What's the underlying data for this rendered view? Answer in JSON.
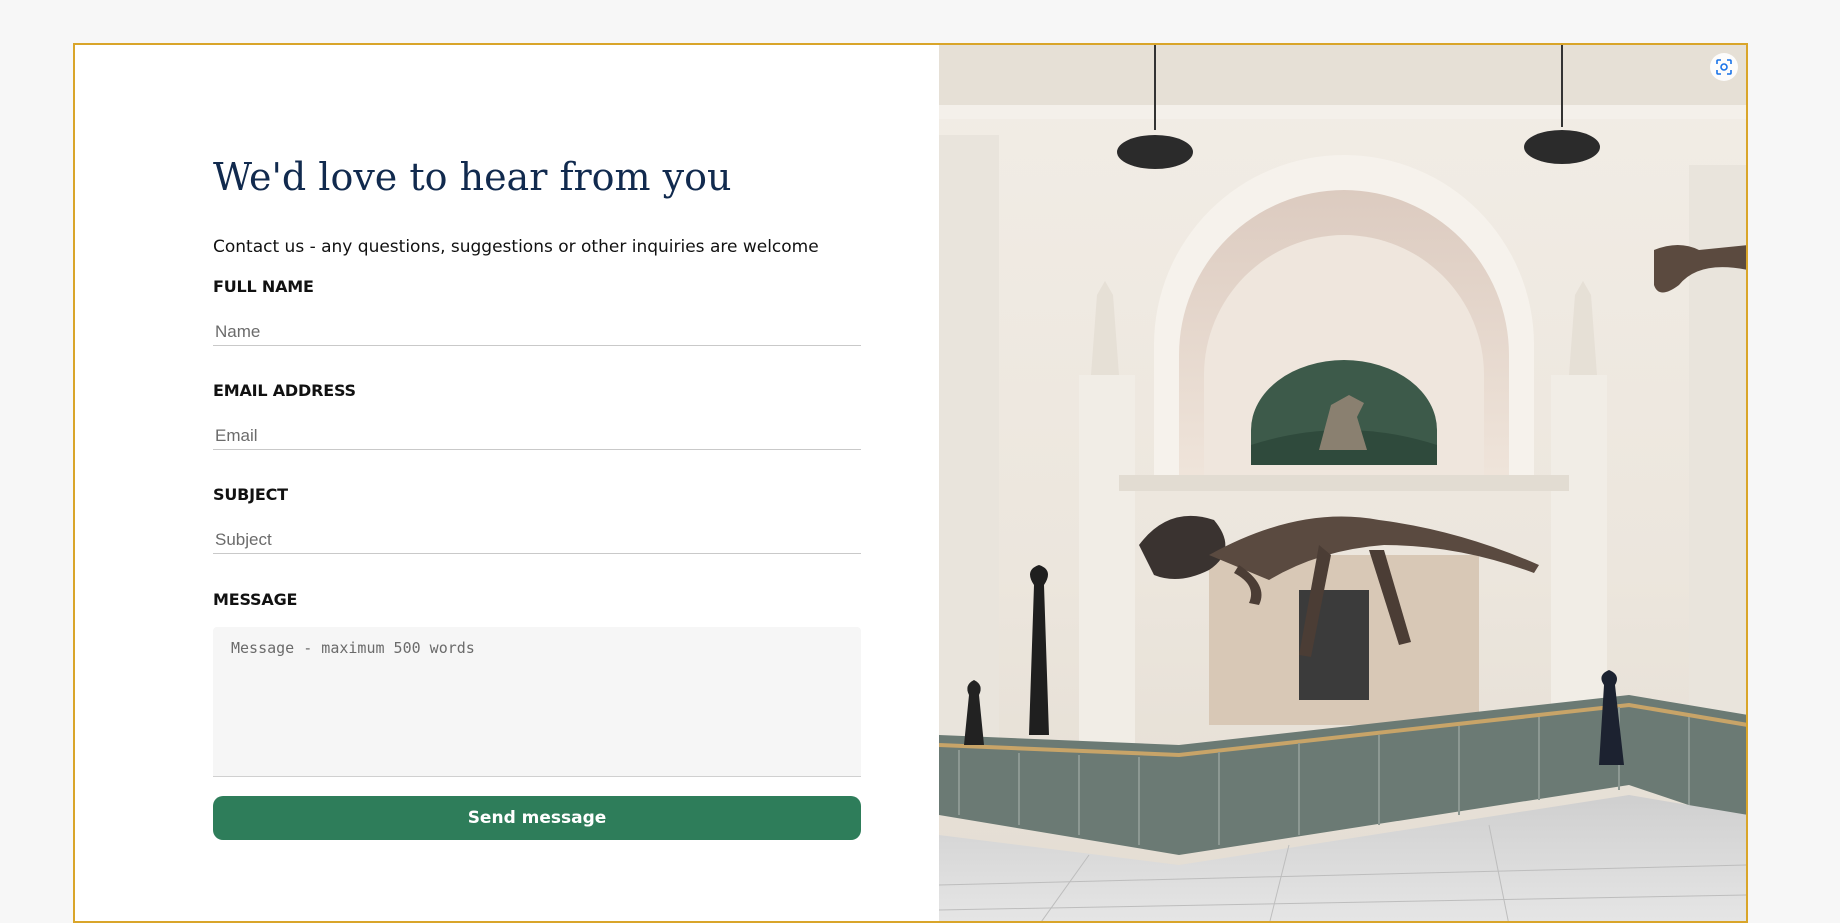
{
  "contact": {
    "title": "We'd love to hear from you",
    "subtitle": "Contact us - any questions, suggestions or other inquiries are welcome",
    "fields": {
      "name": {
        "label": "FULL NAME",
        "placeholder": "Name"
      },
      "email": {
        "label": "EMAIL ADDRESS",
        "placeholder": "Email"
      },
      "subject": {
        "label": "SUBJECT",
        "placeholder": "Subject"
      },
      "message": {
        "label": "MESSAGE",
        "placeholder": "Message - maximum 500 words"
      }
    },
    "send_label": "Send message"
  },
  "photo": {
    "icon": "visual-search-icon"
  },
  "colors": {
    "accent_border": "#d9a52a",
    "button": "#2e7d5a",
    "title": "#112a4e"
  }
}
